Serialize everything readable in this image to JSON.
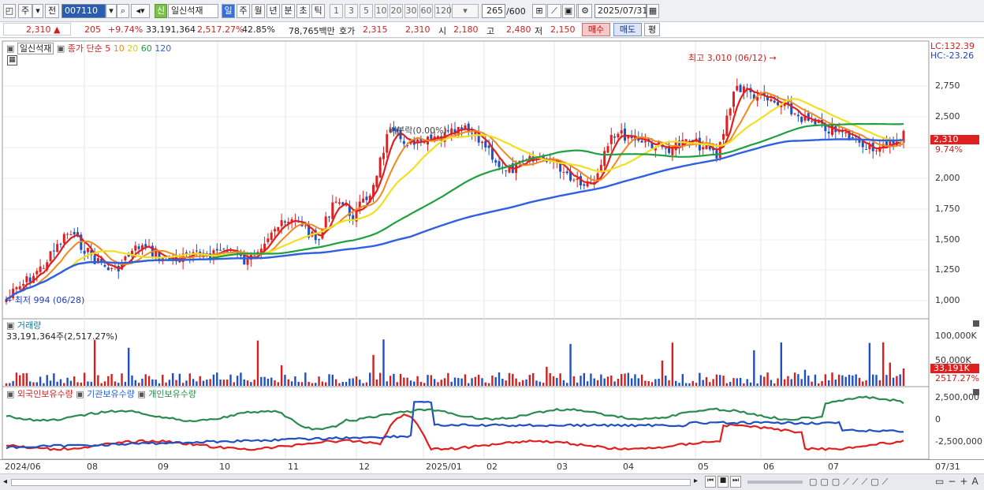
{
  "toolbar": {
    "market": "주",
    "prev_label": "전",
    "code": "007110",
    "stock_name": "일신석재",
    "new_badge": "신",
    "periods": [
      "일",
      "주",
      "월",
      "년",
      "분",
      "초",
      "틱"
    ],
    "intervals": [
      "1",
      "3",
      "5",
      "10",
      "20",
      "30",
      "60",
      "120"
    ],
    "count": "265",
    "count_max": "/600",
    "date": "2025/07/31"
  },
  "quote": {
    "price": "2,310",
    "arrow": "▲",
    "change": "205",
    "change_pct": "+9.74%",
    "volume": "33,191,364",
    "vol_ratio": "2,517.27%",
    "turnover": "42.85%",
    "amount": "78,765백만",
    "bid_label": "호가",
    "bid": "2,315",
    "ask": "2,310",
    "open_label": "시",
    "open": "2,180",
    "high_label": "고",
    "high": "2,480",
    "low_label": "저",
    "low": "2,150",
    "buy": "매수",
    "sell": "매도",
    "eval": "평"
  },
  "price_panel": {
    "title": "일신석재",
    "legend_prefix": "종가 단순",
    "ma": [
      {
        "label": "5",
        "color": "#e02020"
      },
      {
        "label": "10",
        "color": "#f08a20"
      },
      {
        "label": "20",
        "color": "#f0e020"
      },
      {
        "label": "60",
        "color": "#20a040"
      },
      {
        "label": "120",
        "color": "#3060e0"
      }
    ],
    "lc": "LC:132.39",
    "hc": "HC:-23.26",
    "high_note": "최고 3,010 (06/12)",
    "low_note": "최저 994 (06/28)",
    "mid_note": "배분락(0.00%)",
    "yticks": [
      "2,750",
      "2,500",
      "2,250",
      "2,000",
      "1,750",
      "1,500",
      "1,250",
      "1,000"
    ],
    "last_price": "2,310",
    "last_pct": "9.74%"
  },
  "volume_panel": {
    "title": "거래량",
    "value": "33,191,364주(2,517.27%)",
    "yticks": [
      "100,000K",
      "50,000K"
    ],
    "last_vol": "33,191K",
    "last_pct": "2517.27%"
  },
  "holding_panel": {
    "labels": [
      "외국인보유수량",
      "기관보유수량",
      "개인보유수량"
    ],
    "colors": [
      "#e02020",
      "#2060e0",
      "#2a8a50"
    ],
    "yticks": [
      "2,500,000",
      "0",
      "-2,500,000"
    ]
  },
  "x_axis": [
    "2024/06",
    "08",
    "09",
    "10",
    "11",
    "12",
    "2025/01",
    "02",
    "03",
    "04",
    "05",
    "06",
    "07"
  ],
  "x_axis_end": "07/31"
}
